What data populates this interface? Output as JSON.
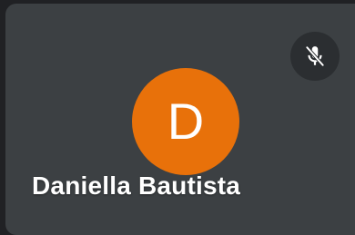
{
  "participant": {
    "name": "Daniella Bautista",
    "initial": "D",
    "avatar_color": "#e8710a",
    "mic_status_icon": "mic-off-icon"
  },
  "colors": {
    "tile_background": "#3c4043",
    "page_background": "#202124",
    "mute_button_background": "#2b2e31"
  }
}
